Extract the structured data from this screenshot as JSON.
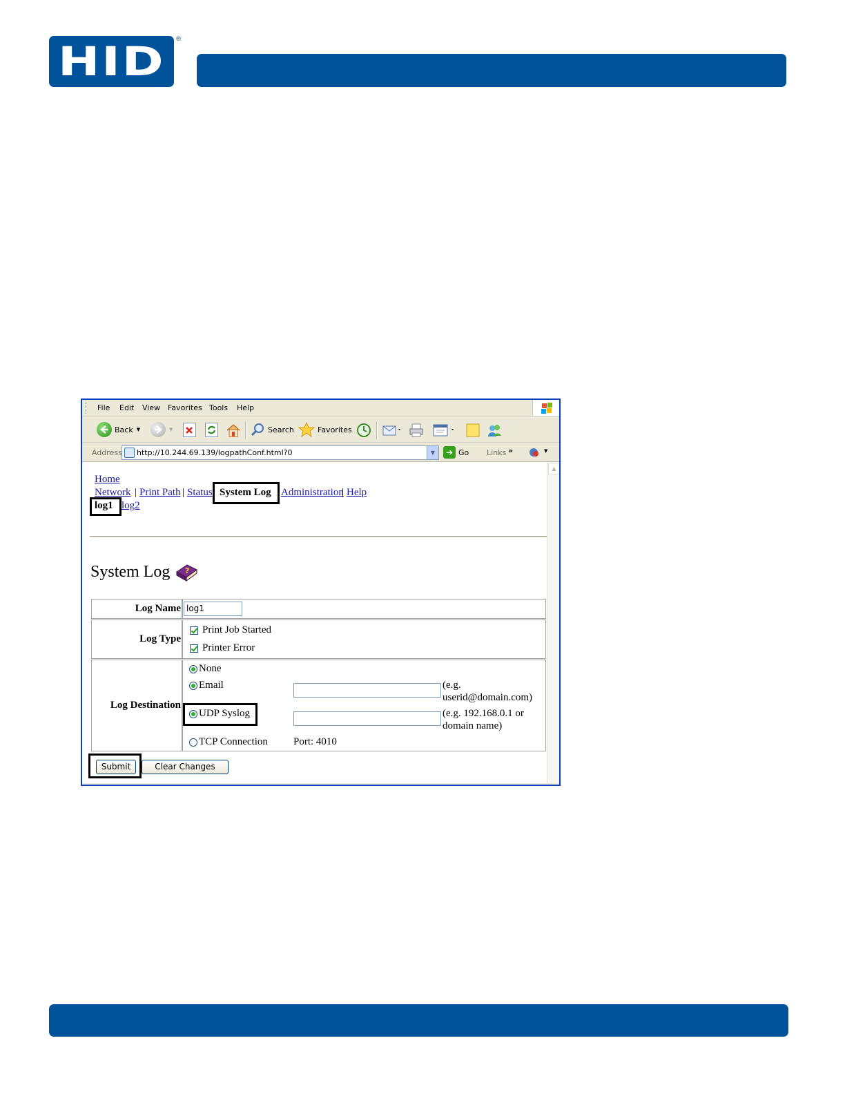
{
  "document": {
    "logo_text": "HID",
    "registered_mark": "®"
  },
  "browser": {
    "menu": [
      "File",
      "Edit",
      "View",
      "Favorites",
      "Tools",
      "Help"
    ],
    "toolbar": {
      "back": "Back",
      "search": "Search",
      "favorites": "Favorites"
    },
    "address": {
      "label": "Address",
      "url": "http://10.244.69.139/logpathConf.html?0",
      "go": "Go",
      "links": "Links",
      "chevron": "»"
    }
  },
  "page": {
    "nav": {
      "home": "Home",
      "network": "Network",
      "print_path": "Print Path",
      "status": "Status",
      "system_log": "System Log",
      "administration": "Administration",
      "help": "Help",
      "separator": "|"
    },
    "subnav": {
      "log1": "log1",
      "log2": "log2"
    },
    "title": "System Log",
    "form": {
      "log_name_label": "Log Name",
      "log_name_value": "log1",
      "log_type_label": "Log Type",
      "log_types": [
        {
          "label": "Print Job Started",
          "checked": true
        },
        {
          "label": "Printer Error",
          "checked": true
        }
      ],
      "log_destination_label": "Log Destination",
      "dest_none": "None",
      "dest_email": "Email",
      "email_hint_1": "(e.g.",
      "email_hint_2": "userid@domain.com)",
      "dest_udp": "UDP Syslog",
      "udp_hint_1": "(e.g. 192.168.0.1 or",
      "udp_hint_2": "domain name)",
      "dest_tcp": "TCP Connection",
      "tcp_port": "Port: 4010",
      "submit": "Submit",
      "clear": "Clear Changes"
    }
  }
}
